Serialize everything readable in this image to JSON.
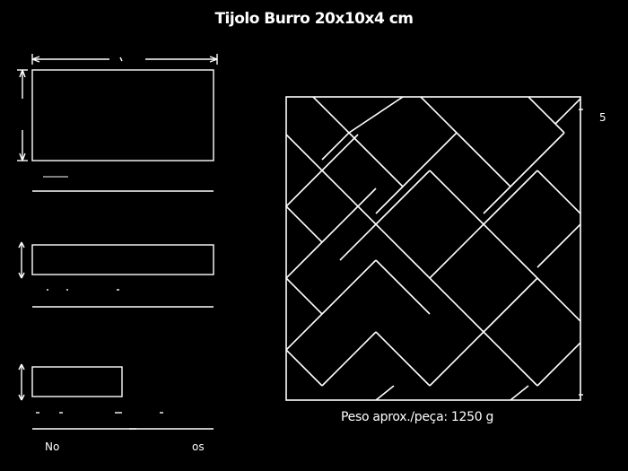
{
  "title": "Tijolo Burro 20x10x4 cm",
  "caption": "Peso aprox./peça: 1250 g",
  "labels": {
    "bottom_left": "No",
    "bottom_right": "os",
    "right_mark": "5"
  },
  "colors": {
    "background": "#000000",
    "line": "#ffffff"
  }
}
